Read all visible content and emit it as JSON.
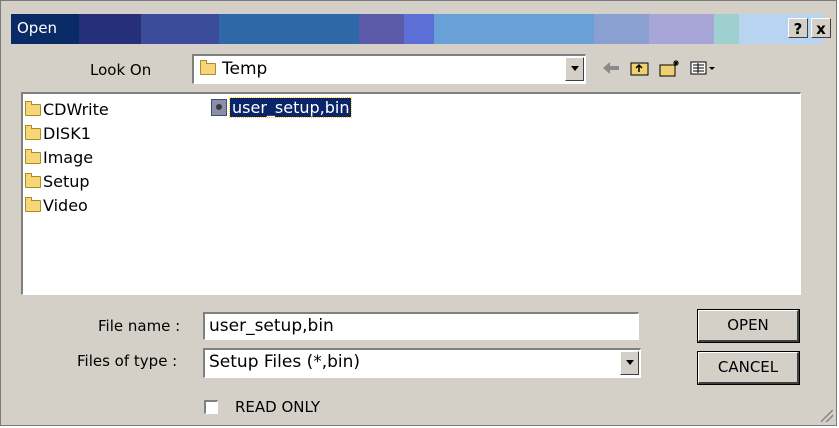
{
  "window": {
    "title": "Open",
    "help_button": "?",
    "close_button": "x",
    "titlebar_colors": [
      "#0a2a66",
      "#26307a",
      "#3a4c9a",
      "#2f68a6",
      "#3e79b8",
      "#5a5aa8",
      "#5b6fd6",
      "#6aa0d8",
      "#8aa0d0",
      "#a8a6d8",
      "#9fd0d0",
      "#b8d4f0"
    ]
  },
  "lookin": {
    "label": "Look On",
    "value": "Temp"
  },
  "toolbar": {
    "back_icon": "back-arrow-icon",
    "up_icon": "up-folder-icon",
    "newfolder_icon": "new-folder-icon",
    "view_icon": "view-menu-icon"
  },
  "folders": [
    "CDWrite",
    "DISK1",
    "Image",
    "Setup",
    "Video"
  ],
  "selected_file": "user_setup,bin",
  "filename": {
    "label": "File name :",
    "value": "user_setup,bin"
  },
  "filetype": {
    "label": "Files of type :",
    "value": "Setup Files (*,bin)"
  },
  "buttons": {
    "open": "OPEN",
    "cancel": "CANCEL"
  },
  "readonly": {
    "label": "READ ONLY"
  }
}
